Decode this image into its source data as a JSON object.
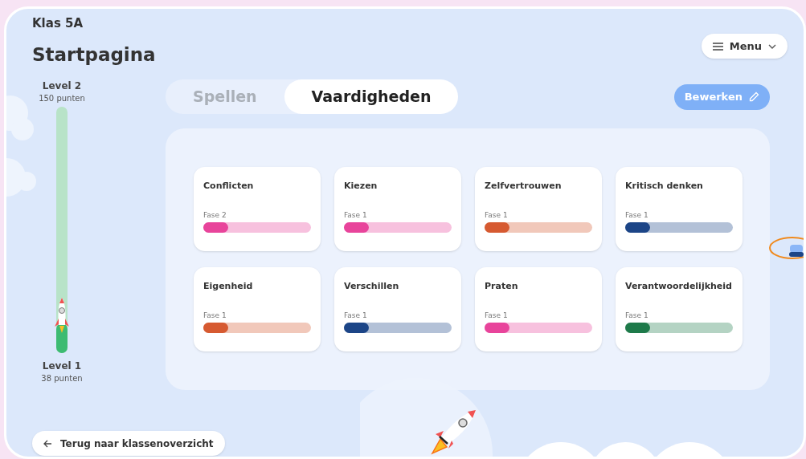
{
  "class_name": "Klas 5A",
  "page_title": "Startpagina",
  "menu_button": {
    "label": "Menu"
  },
  "progress": {
    "top_level": "Level 2",
    "top_points": "150 punten",
    "bottom_level": "Level 1",
    "bottom_points": "38 punten",
    "level": 0.12
  },
  "tabs": [
    {
      "label": "Spellen",
      "selected": false
    },
    {
      "label": "Vaardigheden",
      "selected": true
    }
  ],
  "edit_button": {
    "label": "Bewerken"
  },
  "skills": [
    {
      "name": "Conflicten",
      "phase": "Fase 2",
      "level": 0.23,
      "color": "#e8449b"
    },
    {
      "name": "Kiezen",
      "phase": "Fase 1",
      "level": 0.23,
      "color": "#e8449b"
    },
    {
      "name": "Zelfvertrouwen",
      "phase": "Fase 1",
      "level": 0.23,
      "color": "#d65a31"
    },
    {
      "name": "Kritisch denken",
      "phase": "Fase 1",
      "level": 0.23,
      "color": "#1c4587"
    },
    {
      "name": "Eigenheid",
      "phase": "Fase 1",
      "level": 0.23,
      "color": "#d65a31"
    },
    {
      "name": "Verschillen",
      "phase": "Fase 1",
      "level": 0.23,
      "color": "#1c4587"
    },
    {
      "name": "Praten",
      "phase": "Fase 1",
      "level": 0.23,
      "color": "#e8449b"
    },
    {
      "name": "Verantwoordelijkheid",
      "phase": "Fase 1",
      "level": 0.23,
      "color": "#1e7a4a"
    }
  ],
  "back_button": {
    "label": "Terug naar klassenoverzicht"
  }
}
